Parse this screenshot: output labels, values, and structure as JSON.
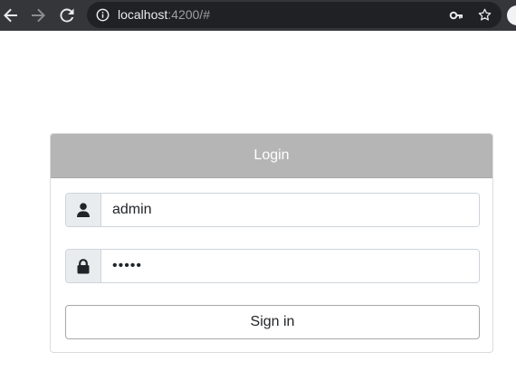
{
  "browser": {
    "url_host": "localhost",
    "url_rest": ":4200/#",
    "icons": {
      "back": "arrow-left-icon",
      "forward": "arrow-right-icon",
      "reload": "reload-icon",
      "site_info": "info-icon",
      "password_key": "key-icon",
      "bookmark": "star-icon"
    },
    "colors": {
      "toolbar": "#35363a",
      "omnibox": "#202124"
    }
  },
  "login": {
    "title": "Login",
    "username": {
      "value": "admin",
      "icon": "user-icon"
    },
    "password": {
      "value": "•••••",
      "icon": "lock-icon"
    },
    "submit_label": "Sign in",
    "colors": {
      "header_bg": "#b5b5b5",
      "addon_bg": "#e9ecef"
    }
  }
}
